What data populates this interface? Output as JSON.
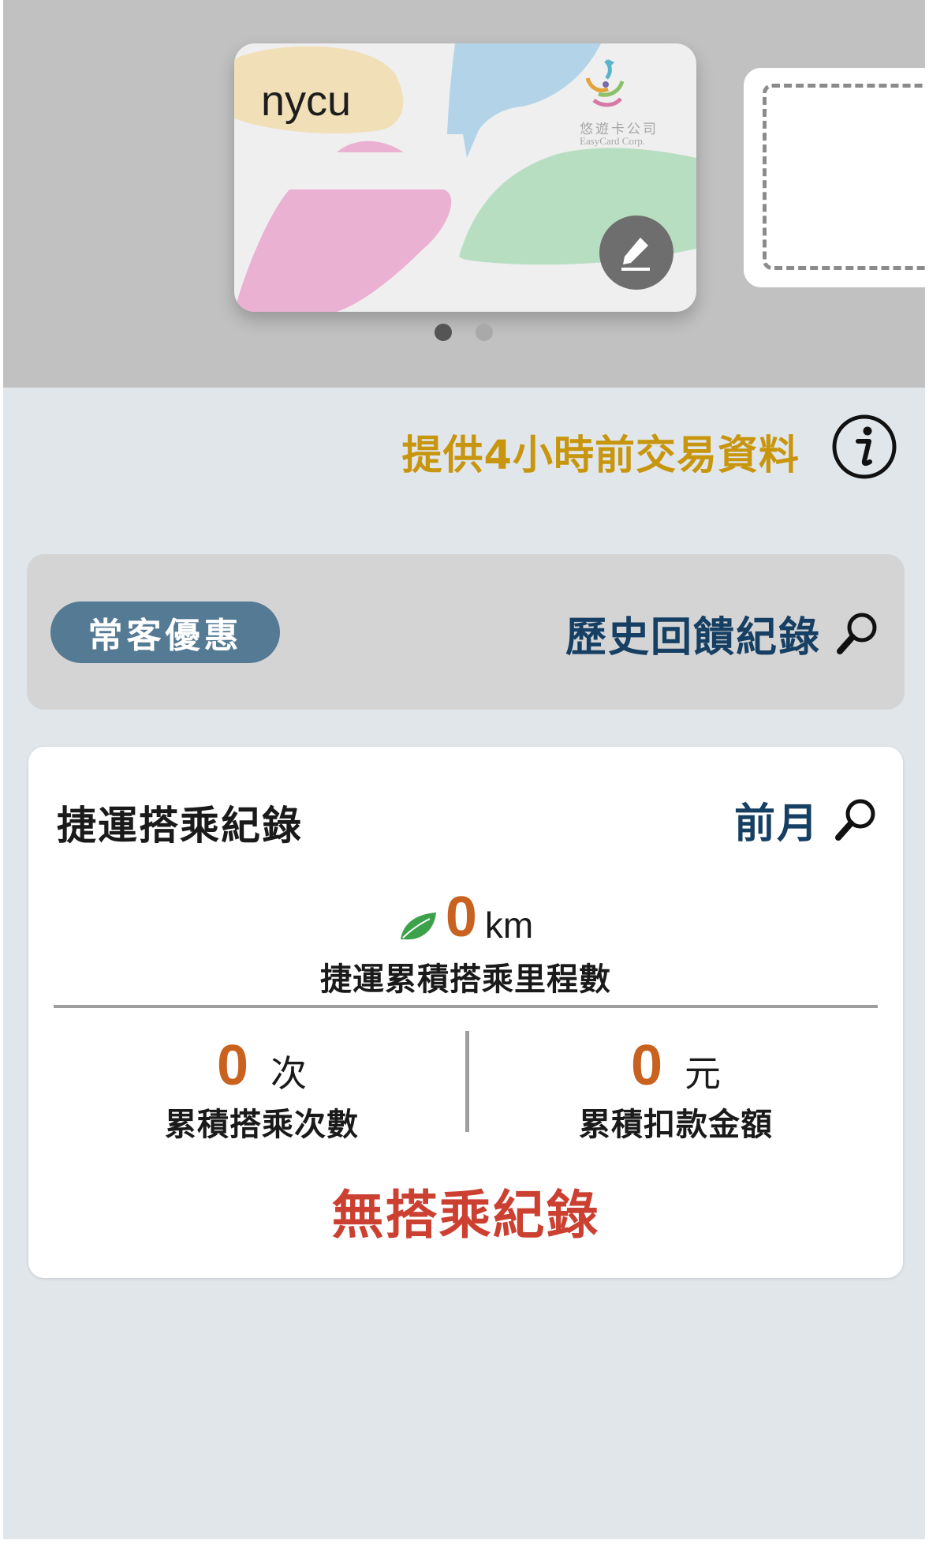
{
  "card": {
    "name": "nycu",
    "issuer_cn": "悠遊卡公司",
    "issuer_en": "EasyCard Corp.",
    "edit_icon": "pencil-icon"
  },
  "carousel": {
    "page_count": 2,
    "active_index": 0,
    "active_dot_color": "#555555",
    "inactive_dot_color": "#a9a9a9"
  },
  "notice": {
    "text": "提供4小時前交易資料",
    "color": "#c8960e",
    "icon": "info-icon"
  },
  "promo": {
    "badge_label": "常客優惠",
    "history_label": "歷史回饋紀錄",
    "icon": "search-icon"
  },
  "mrt_record": {
    "title": "捷運搭乘紀錄",
    "period_label": "前月",
    "distance_value": "0",
    "distance_unit": "km",
    "distance_label": "捷運累積搭乘里程數",
    "rides_value": "0",
    "rides_unit": "次",
    "rides_label": "累積搭乘次數",
    "amount_value": "0",
    "amount_unit": "元",
    "amount_label": "累積扣款金額",
    "empty_message": "無搭乘紀錄",
    "accent_color": "#c8621e",
    "empty_color": "#cb4030",
    "leaf_icon": "leaf-icon"
  }
}
